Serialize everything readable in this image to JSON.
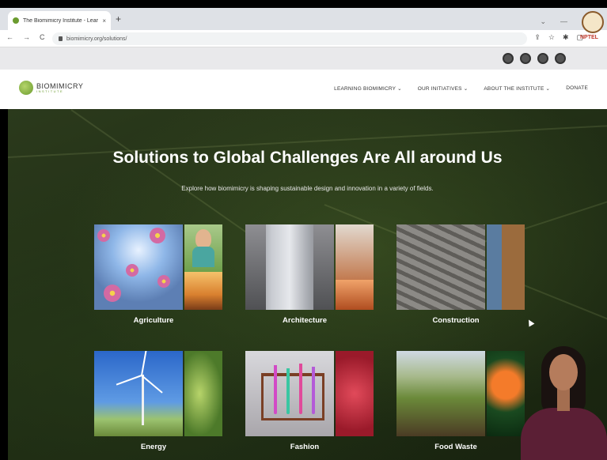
{
  "browser": {
    "tab_title": "The Biomimicry Institute - Learn",
    "tab_close": "×",
    "new_tab": "+",
    "window_controls": [
      "⌄",
      "—"
    ],
    "nav": [
      "←",
      "→",
      "C"
    ],
    "url": "biomimicry.org/solutions/",
    "toolbar_icons": [
      "⇪",
      "☆",
      "✱",
      "▢"
    ]
  },
  "watermark": {
    "text": "NPTEL"
  },
  "site": {
    "logo_name": "BIOMIMICRY",
    "logo_sub": "INSTITUTE",
    "nav": [
      "LEARNING BIOMIMICRY ⌄",
      "OUR INITIATIVES ⌄",
      "ABOUT THE INSTITUTE ⌄",
      "DONATE"
    ]
  },
  "hero": {
    "title": "Solutions to Global Challenges Are All around Us",
    "subtitle": "Explore how biomimicry is shaping sustainable design and innovation in a variety of fields."
  },
  "cards": [
    {
      "label": "Agriculture"
    },
    {
      "label": "Architecture"
    },
    {
      "label": "Construction"
    },
    {
      "label": "Energy"
    },
    {
      "label": "Fashion"
    },
    {
      "label": "Food Waste"
    }
  ]
}
